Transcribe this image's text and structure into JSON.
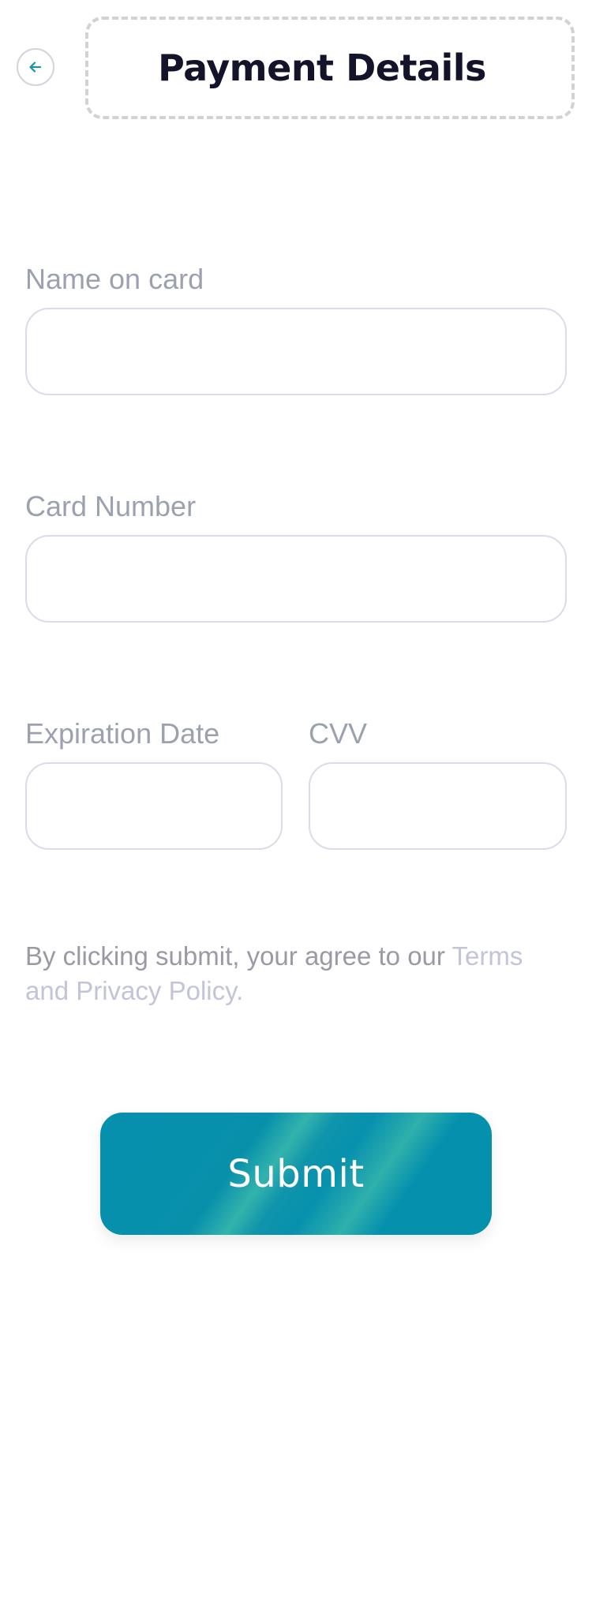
{
  "header": {
    "back_icon": "arrow-left-icon",
    "title": "Payment Details"
  },
  "form": {
    "name_on_card": {
      "label": "Name on card",
      "value": ""
    },
    "card_number": {
      "label": "Card Number",
      "value": ""
    },
    "expiration_date": {
      "label": "Expiration Date",
      "value": ""
    },
    "cvv": {
      "label": "CVV",
      "value": ""
    }
  },
  "terms": {
    "text": "By clicking submit, your agree to our ",
    "link": "Terms and Privacy Policy",
    "suffix": "."
  },
  "submit": {
    "label": "Submit"
  },
  "colors": {
    "accent": "#0590ae",
    "title": "#13132a",
    "label": "#9ca1b0",
    "link": "#c3c4da"
  }
}
